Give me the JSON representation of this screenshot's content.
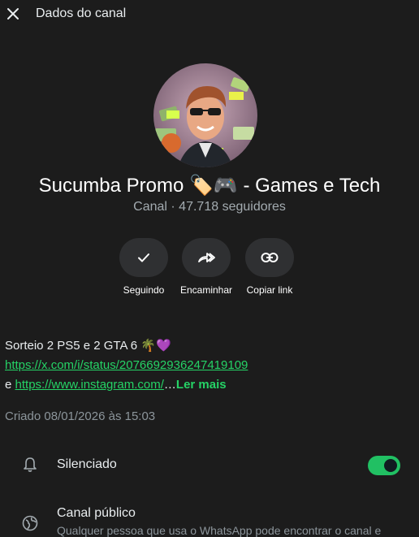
{
  "header": {
    "title": "Dados do canal"
  },
  "channel": {
    "name": "Sucumba Promo 🏷️🎮 - Games e Tech",
    "subtitle": "Canal · 47.718 seguidores"
  },
  "actions": [
    {
      "label": "Seguindo",
      "icon": "check-icon"
    },
    {
      "label": "Encaminhar",
      "icon": "forward-icon"
    },
    {
      "label": "Copiar link",
      "icon": "link-icon"
    }
  ],
  "description": {
    "line1": "Sorteio 2 PS5 e 2 GTA 6 🌴💜",
    "link1": "https://x.com/i/status/2076692936247419109",
    "prefix3": "e ",
    "link2": "https://www.instagram.com/",
    "ellipsis": "…",
    "read_more": "Ler mais"
  },
  "created": "Criado 08/01/2026 às 15:03",
  "settings": {
    "muted": {
      "label": "Silenciado",
      "enabled": true
    },
    "public": {
      "label": "Canal público",
      "description": "Qualquer pessoa que usa o WhatsApp pode encontrar o canal e"
    }
  },
  "colors": {
    "accent": "#25d366",
    "toggle": "#21c063",
    "background": "#1c1c1c"
  }
}
